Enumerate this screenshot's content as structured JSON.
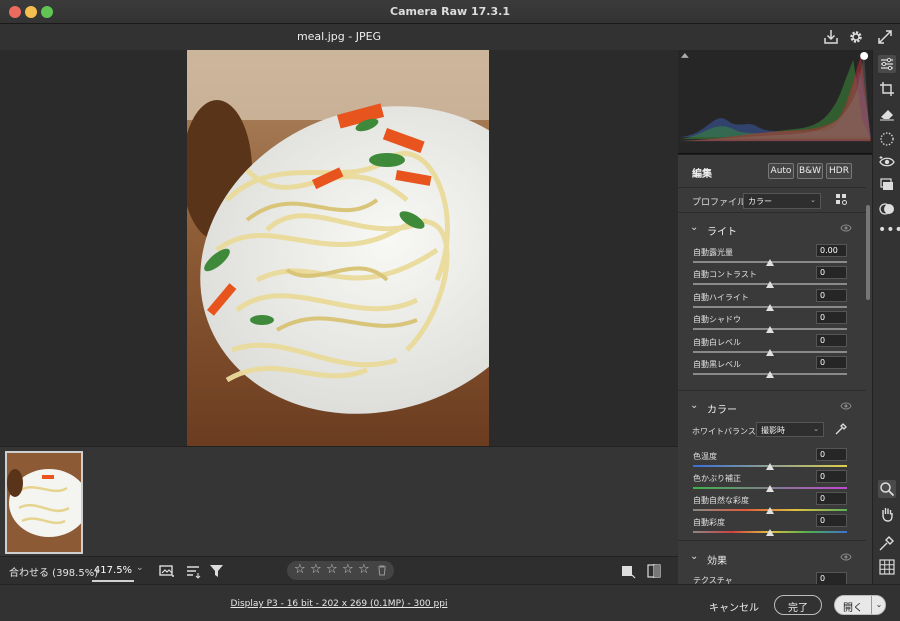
{
  "window": {
    "title": "Camera Raw 17.3.1"
  },
  "header": {
    "file_title": "meal.jpg  -  JPEG"
  },
  "bottombar": {
    "fit_label": "合わせる (398.5%)",
    "zoom_value": "417.5%"
  },
  "status": {
    "info": "Display P3 - 16 bit - 202 x 269 (0.1MP) - 300 ppi"
  },
  "actions": {
    "cancel": "キャンセル",
    "done": "完了",
    "open": "開く"
  },
  "edit_panel": {
    "title": "編集",
    "modes": [
      "Auto",
      "B&W",
      "HDR"
    ],
    "profile_label": "プロファイル",
    "profile_value": "カラー"
  },
  "light_section": {
    "title": "ライト",
    "sliders": [
      {
        "label": "自動露光量",
        "value": "0.00",
        "position": 0.5
      },
      {
        "label": "自動コントラスト",
        "value": "0",
        "position": 0.5
      },
      {
        "label": "自動ハイライト",
        "value": "0",
        "position": 0.5
      },
      {
        "label": "自動シャドウ",
        "value": "0",
        "position": 0.5
      },
      {
        "label": "自動白レベル",
        "value": "0",
        "position": 0.5
      },
      {
        "label": "自動黒レベル",
        "value": "0",
        "position": 0.5
      }
    ]
  },
  "color_section": {
    "title": "カラー",
    "wb_label": "ホワイトバランス",
    "wb_value": "撮影時",
    "sliders": [
      {
        "label": "色温度",
        "value": "0",
        "position": 0.5,
        "gradient": "linear-gradient(90deg,#3a6fd8,#e0d04a)"
      },
      {
        "label": "色かぶり補正",
        "value": "0",
        "position": 0.5,
        "gradient": "linear-gradient(90deg,#3fb24a,#c04ad0)"
      },
      {
        "label": "自動自然な彩度",
        "value": "0",
        "position": 0.5,
        "gradient": "linear-gradient(90deg,#888,#e25b3a,#e0c040,#5ab05a)"
      },
      {
        "label": "自動彩度",
        "value": "0",
        "position": 0.5,
        "gradient": "linear-gradient(90deg,#888,#d04040,#e0c040,#50b050,#4070d0)"
      }
    ]
  },
  "effects_section": {
    "title": "効果",
    "sliders": [
      {
        "label": "テクスチャ",
        "value": "0",
        "position": 0.5
      }
    ]
  },
  "colors": {
    "background": "#1e1e1e",
    "panel": "#3a3a3a",
    "accent": "#e0e0e0"
  }
}
